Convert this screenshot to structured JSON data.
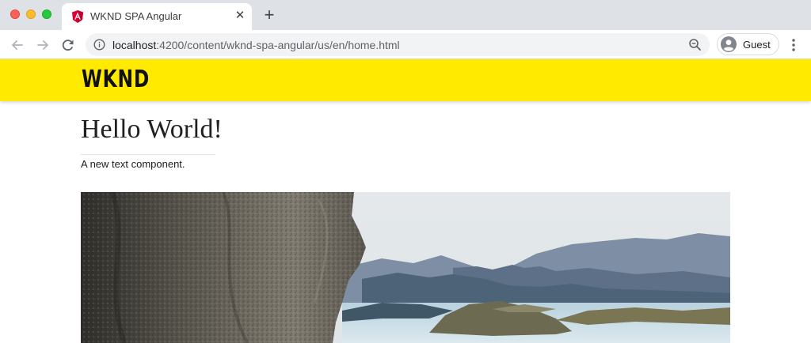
{
  "browser": {
    "tab": {
      "title": "WKND SPA Angular",
      "favicon": "angular-icon",
      "close_icon": "close-icon"
    },
    "new_tab_icon": "plus-icon",
    "toolbar": {
      "back_icon": "arrow-left-icon",
      "forward_icon": "arrow-right-icon",
      "reload_icon": "reload-icon",
      "url_host": "localhost",
      "url_rest": ":4200/content/wknd-spa-angular/us/en/home.html",
      "site_info_icon": "info-icon",
      "zoom_icon": "zoom-out-icon",
      "profile_label": "Guest",
      "profile_icon": "person-icon",
      "menu_icon": "more-vertical-icon"
    }
  },
  "page": {
    "header": {
      "logo": "WKND",
      "background": "#ffea00"
    },
    "title": "Hello World!",
    "text": "A new text component.",
    "image": {
      "subject": "rock cliff overlooking mountain lake"
    }
  }
}
